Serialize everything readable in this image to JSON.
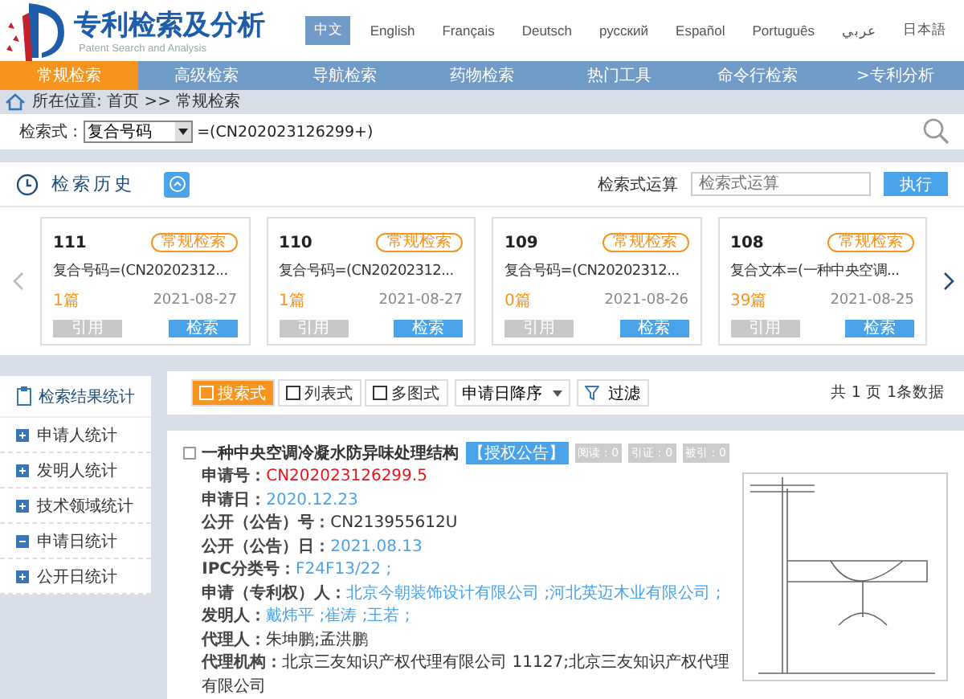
{
  "header": {
    "title": "专利检索及分析",
    "subtitle": "Patent Search and Analysis",
    "languages": [
      {
        "label": "中文",
        "selected": true
      },
      {
        "label": "English",
        "selected": false
      },
      {
        "label": "Français",
        "selected": false
      },
      {
        "label": "Deutsch",
        "selected": false
      },
      {
        "label": "русский",
        "selected": false
      },
      {
        "label": "Español",
        "selected": false
      },
      {
        "label": "Português",
        "selected": false
      },
      {
        "label": "عربي",
        "selected": false
      },
      {
        "label": "日本語",
        "selected": false
      }
    ]
  },
  "nav": [
    {
      "label": "常规检索",
      "selected": true
    },
    {
      "label": "高级检索",
      "selected": false
    },
    {
      "label": "导航检索",
      "selected": false
    },
    {
      "label": "药物检索",
      "selected": false
    },
    {
      "label": "热门工具",
      "selected": false
    },
    {
      "label": "命令行检索",
      "selected": false
    },
    {
      "label": ">专利分析",
      "selected": false
    }
  ],
  "breadcrumb": "所在位置: 首页 >> 常规检索",
  "search": {
    "label": "检索式 :",
    "field": "复合号码",
    "query": "=(CN202023126299+)"
  },
  "history": {
    "title": "检索历史",
    "operation_label": "检索式运算",
    "operation_placeholder": "检索式运算",
    "execute": "执行",
    "cards": [
      {
        "number": "111",
        "tag": "常规检索",
        "query": "复合号码=(CN20202312...",
        "count": "1篇",
        "date": "2021-08-27",
        "cite": "引用",
        "search": "检索"
      },
      {
        "number": "110",
        "tag": "常规检索",
        "query": "复合号码=(CN20202312...",
        "count": "1篇",
        "date": "2021-08-27",
        "cite": "引用",
        "search": "检索"
      },
      {
        "number": "109",
        "tag": "常规检索",
        "query": "复合号码=(CN20202312...",
        "count": "0篇",
        "date": "2021-08-26",
        "cite": "引用",
        "search": "检索"
      },
      {
        "number": "108",
        "tag": "常规检索",
        "query": "复合文本=(一种中央空调...",
        "count": "39篇",
        "date": "2021-08-25",
        "cite": "引用",
        "search": "检索"
      }
    ]
  },
  "stats": {
    "title": "检索结果统计",
    "items": [
      {
        "label": "申请人统计",
        "expanded": false
      },
      {
        "label": "发明人统计",
        "expanded": false
      },
      {
        "label": "技术领域统计",
        "expanded": false
      },
      {
        "label": "申请日统计",
        "expanded": true
      },
      {
        "label": "公开日统计",
        "expanded": false
      }
    ]
  },
  "toolbar": {
    "views": [
      {
        "label": "搜索式",
        "selected": true
      },
      {
        "label": "列表式",
        "selected": false
      },
      {
        "label": "多图式",
        "selected": false
      }
    ],
    "sort": "申请日降序",
    "filter": "过滤",
    "page_info": "共 1 页 1条数据"
  },
  "result": {
    "checked": false,
    "title": "一种中央空调冷凝水防异味处理结构",
    "tag": "【授权公告】",
    "counts": [
      "阅读：0",
      "引证：0",
      "被引：0"
    ],
    "fields": [
      {
        "label": "申请号：",
        "value": "CN202023126299.5",
        "kind": "highlight"
      },
      {
        "label": "申请日：",
        "value": "2020.12.23",
        "kind": "link"
      },
      {
        "label": "公开（公告）号：",
        "value": "CN213955612U",
        "kind": "plain"
      },
      {
        "label": "公开（公告）日：",
        "value": "2021.08.13",
        "kind": "link"
      },
      {
        "label": "IPC分类号：",
        "value": "F24F13/22 ;",
        "kind": "link"
      },
      {
        "label": "申请（专利权）人：",
        "value": "北京今朝装饰设计有限公司 ;河北英迈木业有限公司 ;",
        "kind": "link"
      },
      {
        "label": "发明人：",
        "value": "戴炜平 ;崔涛 ;王若 ;",
        "kind": "link"
      },
      {
        "label": "代理人：",
        "value": "朱坤鹏;孟洪鹏",
        "kind": "plain"
      },
      {
        "label": "代理机构：",
        "value": "北京三友知识产权代理有限公司 11127;北京三友知识产权代理有限公司",
        "kind": "plain"
      }
    ]
  }
}
